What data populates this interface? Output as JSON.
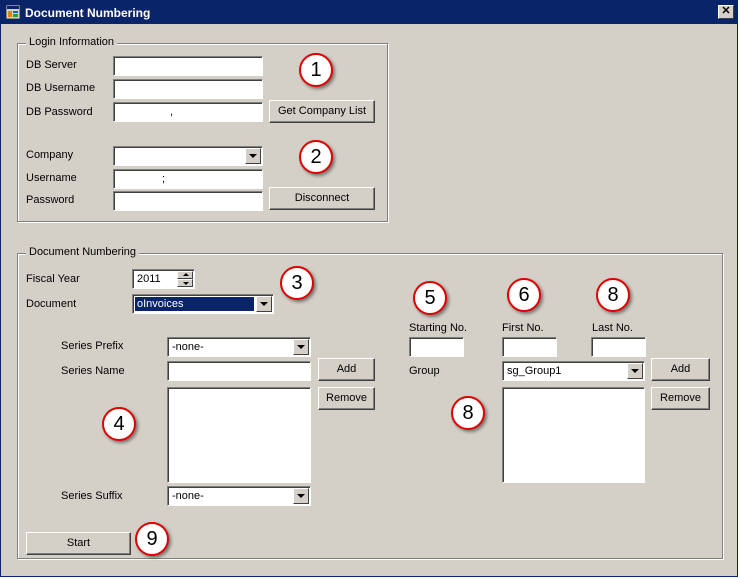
{
  "window": {
    "title": "Document Numbering",
    "close_glyph": "✕",
    "icon": "app-window-icon"
  },
  "login": {
    "group_title": "Login Information",
    "db_server_label": "DB Server",
    "db_username_label": "DB Username",
    "db_password_label": "DB Password",
    "db_server_value": "",
    "db_username_value": "",
    "db_password_value": ",",
    "get_company_list_label": "Get Company List",
    "company_label": "Company",
    "company_value": "",
    "username_label": "Username",
    "username_value": ";",
    "password_label": "Password",
    "password_value": "",
    "disconnect_label": "Disconnect"
  },
  "numbering": {
    "group_title": "Document Numbering",
    "fiscal_year_label": "Fiscal Year",
    "fiscal_year_value": "2011",
    "document_label": "Document",
    "document_value": "oInvoices",
    "series_prefix_label": "Series Prefix",
    "series_prefix_value": "-none-",
    "series_name_label": "Series Name",
    "series_name_value": "",
    "add_label": "Add",
    "remove_label": "Remove",
    "series_suffix_label": "Series Suffix",
    "series_suffix_value": "-none-",
    "starting_no_label": "Starting No.",
    "first_no_label": "First No.",
    "last_no_label": "Last No.",
    "starting_no_value": "",
    "first_no_value": "",
    "last_no_value": "",
    "group_label": "Group",
    "group_value": "sg_Group1",
    "group_add_label": "Add",
    "group_remove_label": "Remove",
    "start_label": "Start"
  },
  "markers": [
    "1",
    "2",
    "3",
    "4",
    "5",
    "6",
    "8",
    "8",
    "9"
  ],
  "colors": {
    "titlebar": "#0a246a",
    "face": "#d4d0c8",
    "selection": "#0a246a",
    "marker_border": "#e00000"
  }
}
